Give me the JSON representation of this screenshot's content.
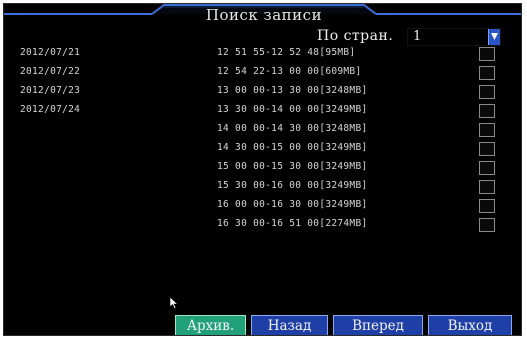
{
  "window": {
    "title": "Поиск записи"
  },
  "page_selector": {
    "label": "По стран.",
    "value": "1"
  },
  "dates": [
    "2012/07/21",
    "2012/07/22",
    "2012/07/23",
    "2012/07/24"
  ],
  "records": [
    {
      "time": "12 51 55-12 52 48[95MB]"
    },
    {
      "time": "12 54 22-13 00 00[609MB]"
    },
    {
      "time": "13 00 00-13 30 00[3248MB]"
    },
    {
      "time": "13 30 00-14 00 00[3249MB]"
    },
    {
      "time": "14 00 00-14 30 00[3248MB]"
    },
    {
      "time": "14 30 00-15 00 00[3249MB]"
    },
    {
      "time": "15 00 00-15 30 00[3249MB]"
    },
    {
      "time": "15 30 00-16 00 00[3249MB]"
    },
    {
      "time": "16 00 00-16 30 00[3249MB]"
    },
    {
      "time": "16 30 00-16 51 00[2274MB]"
    }
  ],
  "buttons": {
    "archive": "Архив.",
    "back": "Назад",
    "forward": "Вперед",
    "exit": "Выход"
  },
  "colors": {
    "background": "#000000",
    "button_blue": "#1e3fa6",
    "button_active": "#22a07a",
    "dropdown_arrow": "#2a55c8"
  }
}
